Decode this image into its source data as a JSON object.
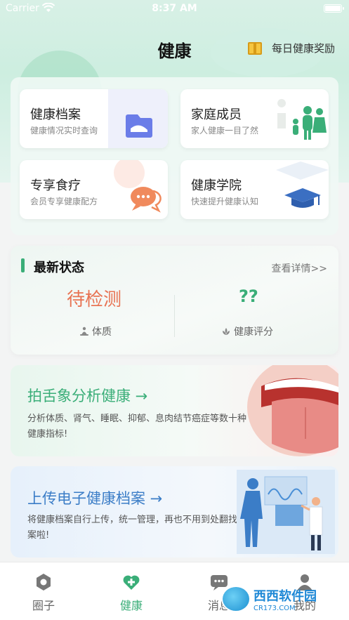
{
  "status_bar": {
    "carrier": "Carrier",
    "time": "8:37 AM"
  },
  "header": {
    "title": "健康",
    "reward_label": "每日健康奖励"
  },
  "cards": [
    {
      "title": "健康档案",
      "subtitle": "健康情况实时查询",
      "icon": "folder-icon"
    },
    {
      "title": "家庭成员",
      "subtitle": "家人健康一目了然",
      "icon": "family-icon"
    },
    {
      "title": "专享食疗",
      "subtitle": "会员专享健康配方",
      "icon": "chat-bubble-icon"
    },
    {
      "title": "健康学院",
      "subtitle": "快速提升健康认知",
      "icon": "graduation-cap-icon"
    }
  ],
  "status_panel": {
    "title": "最新状态",
    "more": "查看详情>>",
    "constitution_value": "待检测",
    "constitution_label": "体质",
    "score_value": "??",
    "score_label": "健康评分"
  },
  "tongue_banner": {
    "title": "拍舌象分析健康 →",
    "description": "分析体质、肾气、睡眠、抑郁、息肉结节癌症等数十种健康指标!"
  },
  "upload_banner": {
    "title": "上传电子健康档案 →",
    "description": "将健康档案自行上传，统一管理，再也不用到处翻找档案啦!"
  },
  "tabs": [
    {
      "label": "圈子",
      "icon": "circle-hex-icon",
      "active": false
    },
    {
      "label": "健康",
      "icon": "heart-plus-icon",
      "active": true
    },
    {
      "label": "消息",
      "icon": "message-icon",
      "active": false
    },
    {
      "label": "我的",
      "icon": "user-icon",
      "active": false
    }
  ],
  "watermark": {
    "main": "西西软件园",
    "sub": "CR173.COM"
  },
  "colors": {
    "accent_green": "#3aae78",
    "accent_blue": "#3b7dc7",
    "pending_orange": "#e87454"
  }
}
